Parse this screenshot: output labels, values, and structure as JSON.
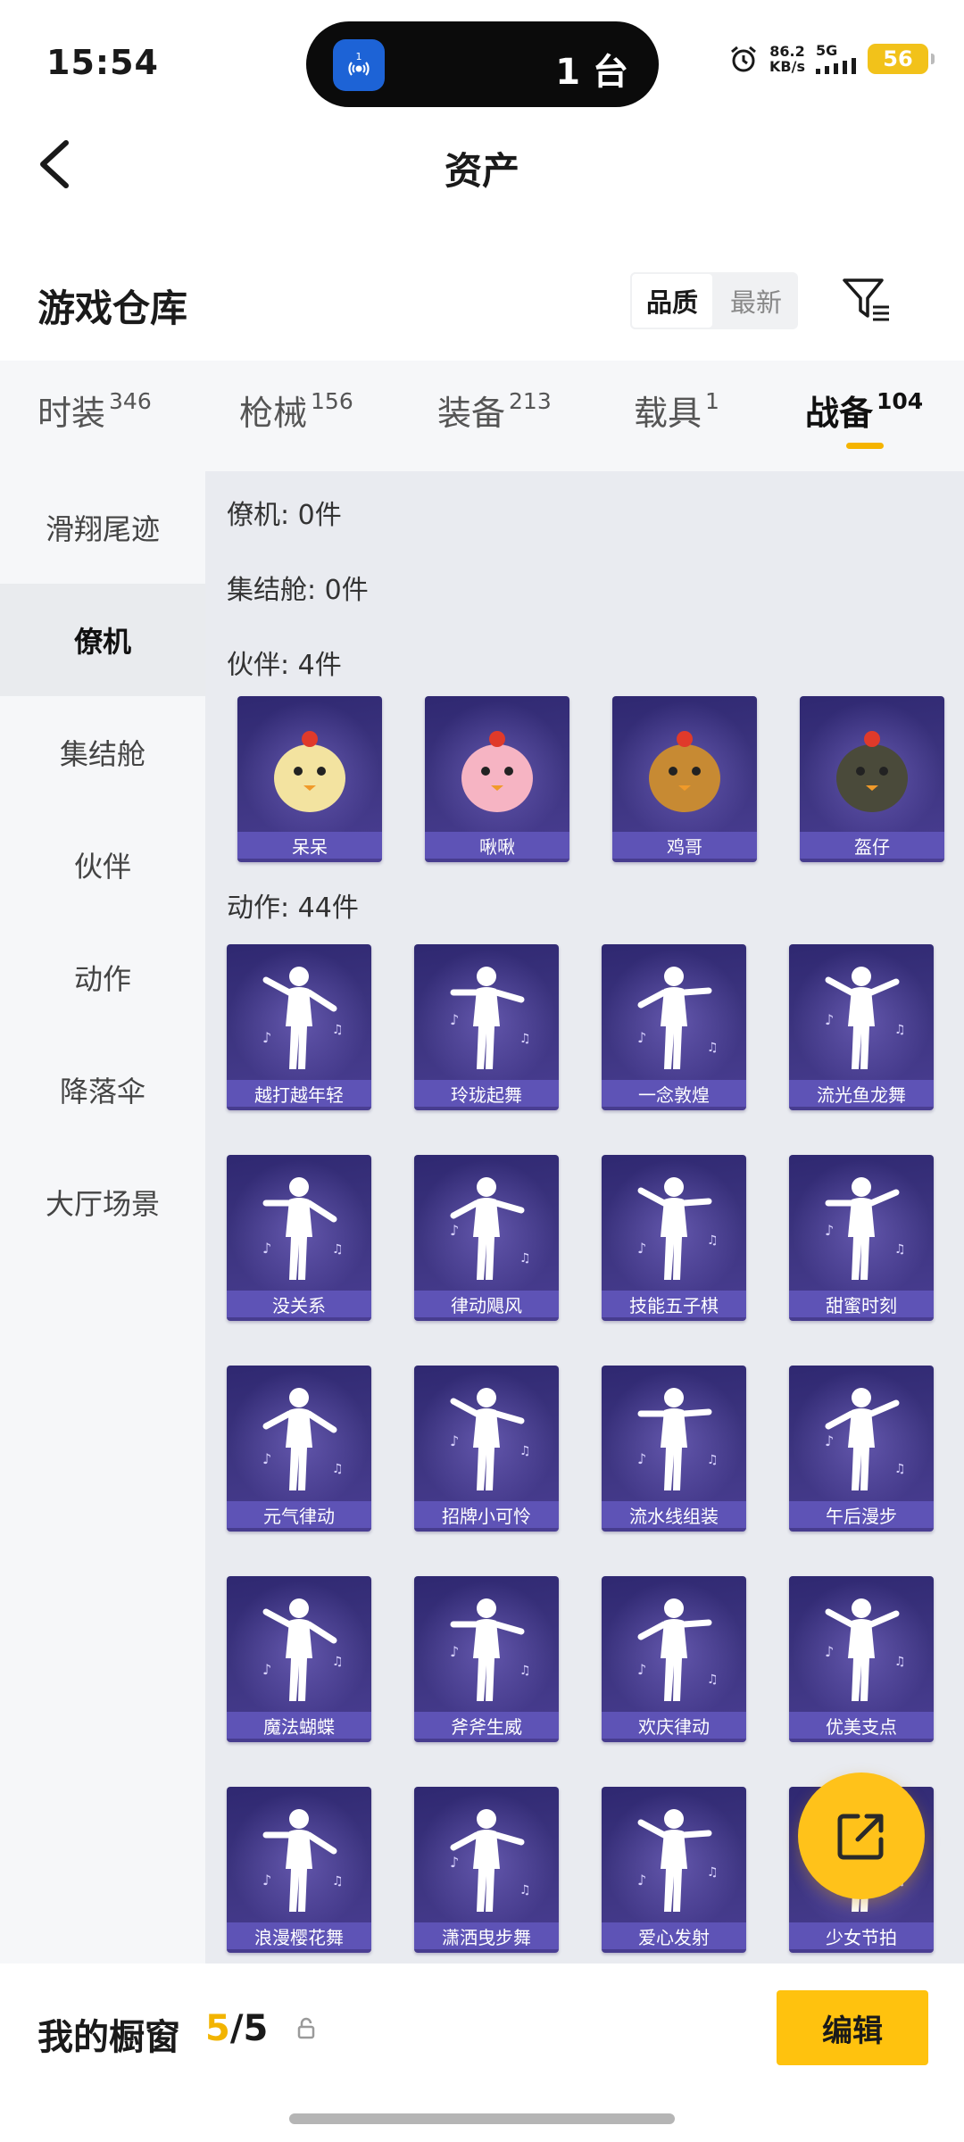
{
  "status_bar": {
    "time": "15:54",
    "island_badge": "1",
    "island_count": "1 台",
    "net_speed_value": "86.2",
    "net_speed_unit": "KB/s",
    "network": "5G",
    "battery": "56",
    "battery_color": "#f2c21a"
  },
  "nav": {
    "title": "资产",
    "back_icon": "chevron-left-icon"
  },
  "warehouse": {
    "title": "游戏仓库",
    "sort_options": [
      "品质",
      "最新"
    ],
    "sort_selected": "品质",
    "filter_icon": "filter-icon"
  },
  "tabs": [
    {
      "label": "时装",
      "count": "346"
    },
    {
      "label": "枪械",
      "count": "156"
    },
    {
      "label": "装备",
      "count": "213"
    },
    {
      "label": "载具",
      "count": "1"
    },
    {
      "label": "战备",
      "count": "104"
    }
  ],
  "active_tab": "战备",
  "sidebar": [
    {
      "label": "滑翔尾迹"
    },
    {
      "label": "僚机"
    },
    {
      "label": "集结舱"
    },
    {
      "label": "伙伴"
    },
    {
      "label": "动作"
    },
    {
      "label": "降落伞"
    },
    {
      "label": "大厅场景"
    }
  ],
  "sidebar_active": "僚机",
  "sections": [
    {
      "label": "僚机: 0件"
    },
    {
      "label": "集结舱: 0件"
    },
    {
      "label": "伙伴: 4件"
    },
    {
      "label": "动作: 44件"
    }
  ],
  "partners": [
    "呆呆",
    "啾啾",
    "鸡哥",
    "盔仔"
  ],
  "actions": [
    "越打越年轻",
    "玲珑起舞",
    "一念敦煌",
    "流光鱼龙舞",
    "没关系",
    "律动飓风",
    "技能五子棋",
    "甜蜜时刻",
    "元气律动",
    "招牌小可怜",
    "流水线组装",
    "午后漫步",
    "魔法蝴蝶",
    "斧斧生威",
    "欢庆律动",
    "优美支点",
    "浪漫樱花舞",
    "潇洒曳步舞",
    "爱心发射",
    "少女节拍"
  ],
  "showcase": {
    "title": "我的橱窗",
    "current": "5",
    "separator": "/",
    "total": "5",
    "edit_label": "编辑",
    "accent": "#ffc20e"
  },
  "fab_icon": "share-external-icon"
}
